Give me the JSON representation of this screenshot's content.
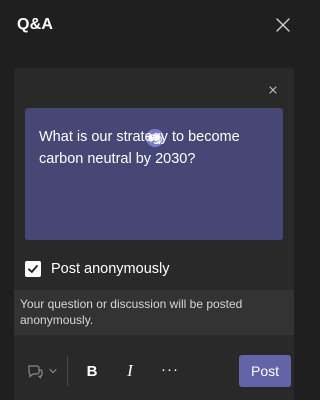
{
  "header": {
    "title": "Q&A",
    "close_icon": "close-icon"
  },
  "composer": {
    "dismiss_icon": "close-icon",
    "bubble_icon": "chat-bubbles-icon",
    "question": "What is our strategy to become carbon neutral by 2030?",
    "post_anonymously": {
      "label": "Post anonymously",
      "checked": true
    },
    "info": "Your question or discussion will be posted anonymously."
  },
  "toolbar": {
    "emoji_icon": "chat-bubble-icon",
    "dropdown_icon": "chevron-down-icon",
    "bold_label": "B",
    "italic_label": "I",
    "more_label": "···",
    "post_label": "Post"
  },
  "colors": {
    "background": "#1f1f1f",
    "panel": "#292929",
    "question_card": "#464775",
    "accent": "#6264a7",
    "info_bar": "#333333"
  }
}
